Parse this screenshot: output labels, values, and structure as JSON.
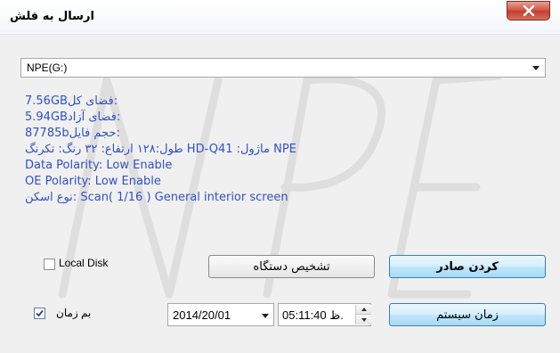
{
  "window": {
    "title": "ارسال به فلش",
    "close_icon": "close-icon"
  },
  "drive_select": {
    "value": "NPE(G:)"
  },
  "info": {
    "total_space": "7.56GBفضای کل:",
    "free_space": "5.94GBفضای آزاد:",
    "file_size": "87785bحجم فایل:",
    "module_line": "طول:۱۲۸ ارتفاع: ۳۲ رنگ: تکرنگ HD-Q41 :ماژول NPE",
    "data_polarity": "Data Polarity: Low Enable",
    "oe_polarity": "OE Polarity: Low Enable",
    "scan_type": "نوع اسکن: Scan( 1/16 ) General interior screen"
  },
  "controls": {
    "local_disk_label": "Local Disk",
    "local_disk_checked": false,
    "detect_device_label": "تشخیص دستگاه",
    "export_label": "کردن صادر",
    "time_checkbox_label": "بم زمان",
    "time_checkbox_checked": true,
    "date_value": "2014/20/01",
    "time_value": "05:11:40 ظ.",
    "system_time_label": "زمان سیستم"
  },
  "watermark": "NPE",
  "colors": {
    "info_text": "#3050c8",
    "close_button": "#c33f2e",
    "primary_button": "#bee6fd",
    "watermark": "#d8d8d8"
  }
}
